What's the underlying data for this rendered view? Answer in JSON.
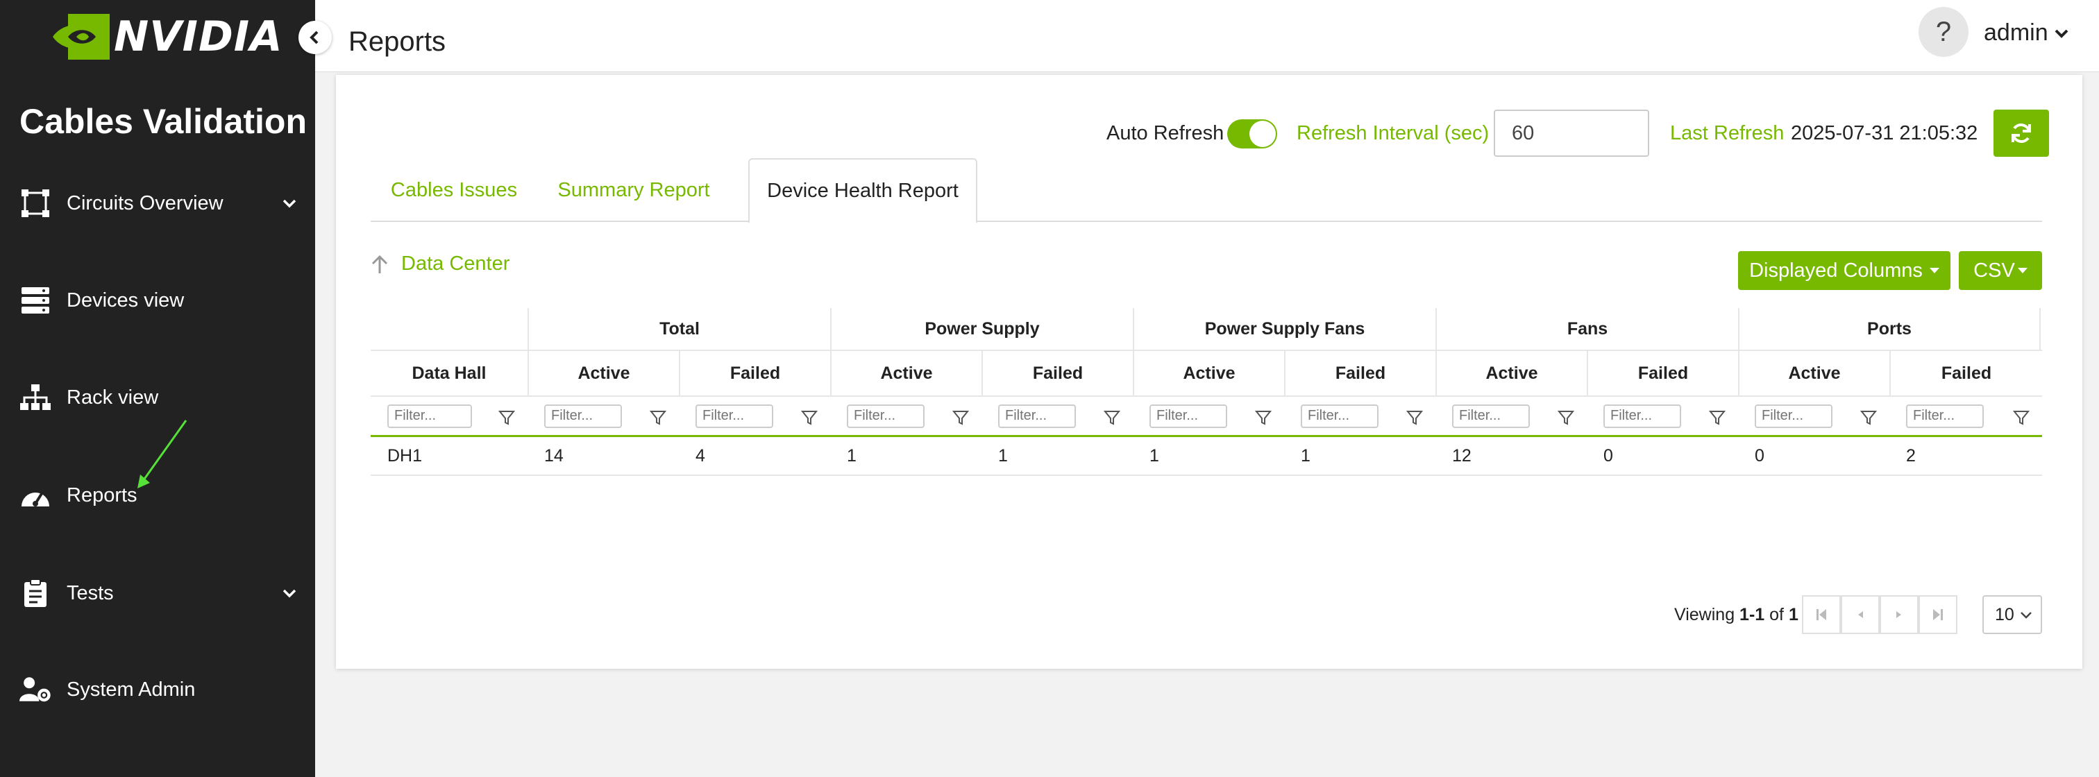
{
  "brand": {
    "logo_text": "NVIDIA",
    "accent": "#76b900",
    "sidebar_bg": "#222222"
  },
  "sidebar": {
    "app_title": "Cables Validation",
    "items": [
      {
        "label": "Circuits Overview",
        "icon": "circuit-icon",
        "has_submenu": true
      },
      {
        "label": "Devices view",
        "icon": "server-icon",
        "has_submenu": false
      },
      {
        "label": "Rack view",
        "icon": "sitemap-icon",
        "has_submenu": false
      },
      {
        "label": "Reports",
        "icon": "gauge-icon",
        "has_submenu": false
      },
      {
        "label": "Tests",
        "icon": "clipboard-icon",
        "has_submenu": true
      },
      {
        "label": "System Admin",
        "icon": "user-gear-icon",
        "has_submenu": false
      }
    ]
  },
  "header": {
    "title": "Reports",
    "help": "?",
    "user": "admin"
  },
  "refresh": {
    "auto_refresh_label": "Auto Refresh",
    "auto_refresh_on": true,
    "interval_label": "Refresh Interval (sec)",
    "interval_value": "60",
    "last_refresh_label": "Last Refresh",
    "last_refresh_value": "2025-07-31 21:05:32"
  },
  "tabs": [
    {
      "label": "Cables Issues",
      "active": false
    },
    {
      "label": "Summary Report",
      "active": false
    },
    {
      "label": "Device Health Report",
      "active": true
    }
  ],
  "breadcrumb": {
    "label": "Data Center"
  },
  "toolbar": {
    "columns_label": "Displayed Columns",
    "csv_label": "CSV"
  },
  "table": {
    "groups": [
      "",
      "Total",
      "Power Supply",
      "Power Supply Fans",
      "Fans",
      "Ports"
    ],
    "columns": [
      "Data Hall",
      "Active",
      "Failed",
      "Active",
      "Failed",
      "Active",
      "Failed",
      "Active",
      "Failed",
      "Active",
      "Failed"
    ],
    "filter_placeholder": "Filter...",
    "rows": [
      [
        "DH1",
        "14",
        "4",
        "1",
        "1",
        "1",
        "1",
        "12",
        "0",
        "0",
        "2"
      ]
    ]
  },
  "pagination": {
    "prefix": "Viewing ",
    "range": "1-1",
    "of": " of ",
    "total": "1",
    "page_size": "10"
  }
}
